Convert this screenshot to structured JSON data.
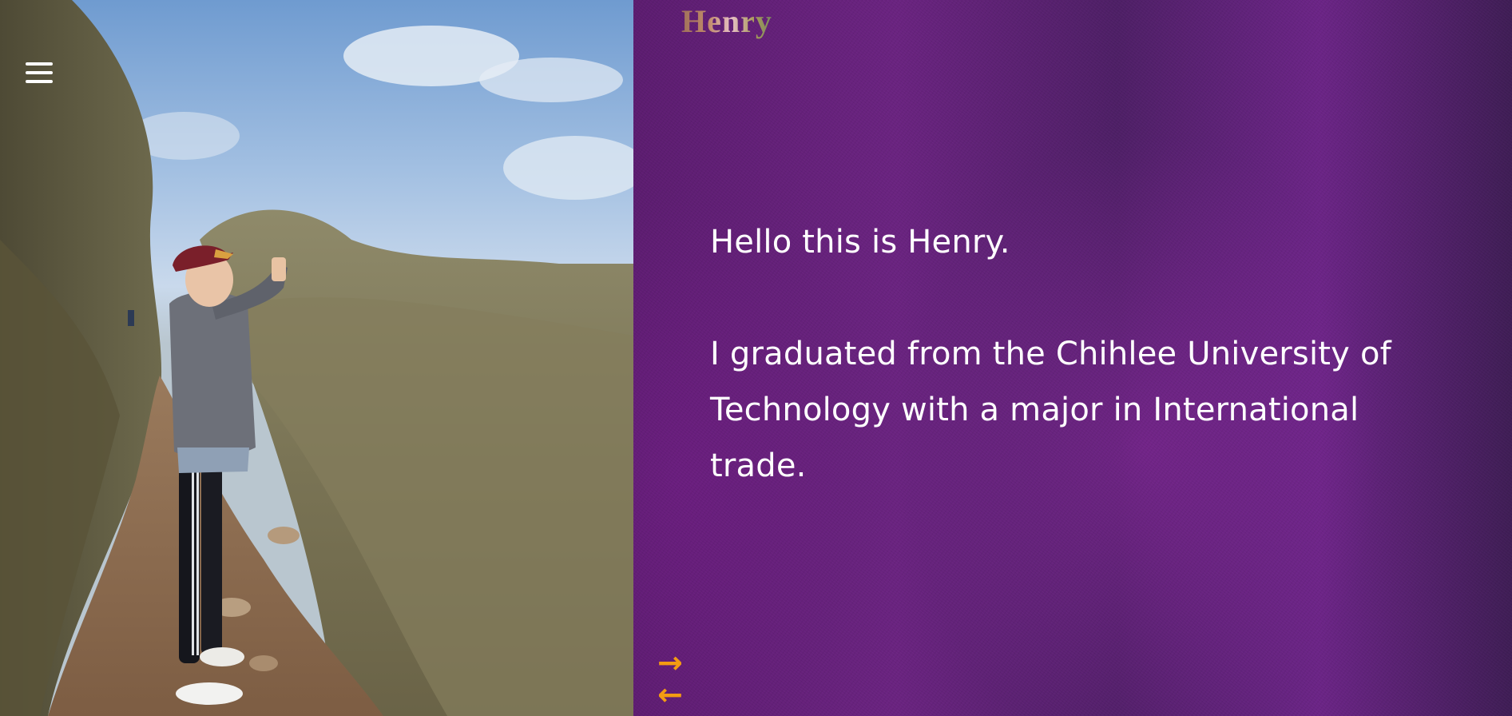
{
  "header": {
    "brand": "Henry",
    "menu_icon": "hamburger-menu-icon"
  },
  "intro": {
    "greeting": "Hello this is Henry.",
    "bio": "I graduated from the Chihlee University of Technology with a major in International trade."
  },
  "navigation": {
    "next_arrow": "→",
    "prev_arrow": "←",
    "next_icon": "arrow-right-icon",
    "prev_icon": "arrow-left-icon"
  },
  "colors": {
    "panel_purple": "#6a2380",
    "arrow_orange": "#f39c12",
    "text": "#ffffff"
  }
}
